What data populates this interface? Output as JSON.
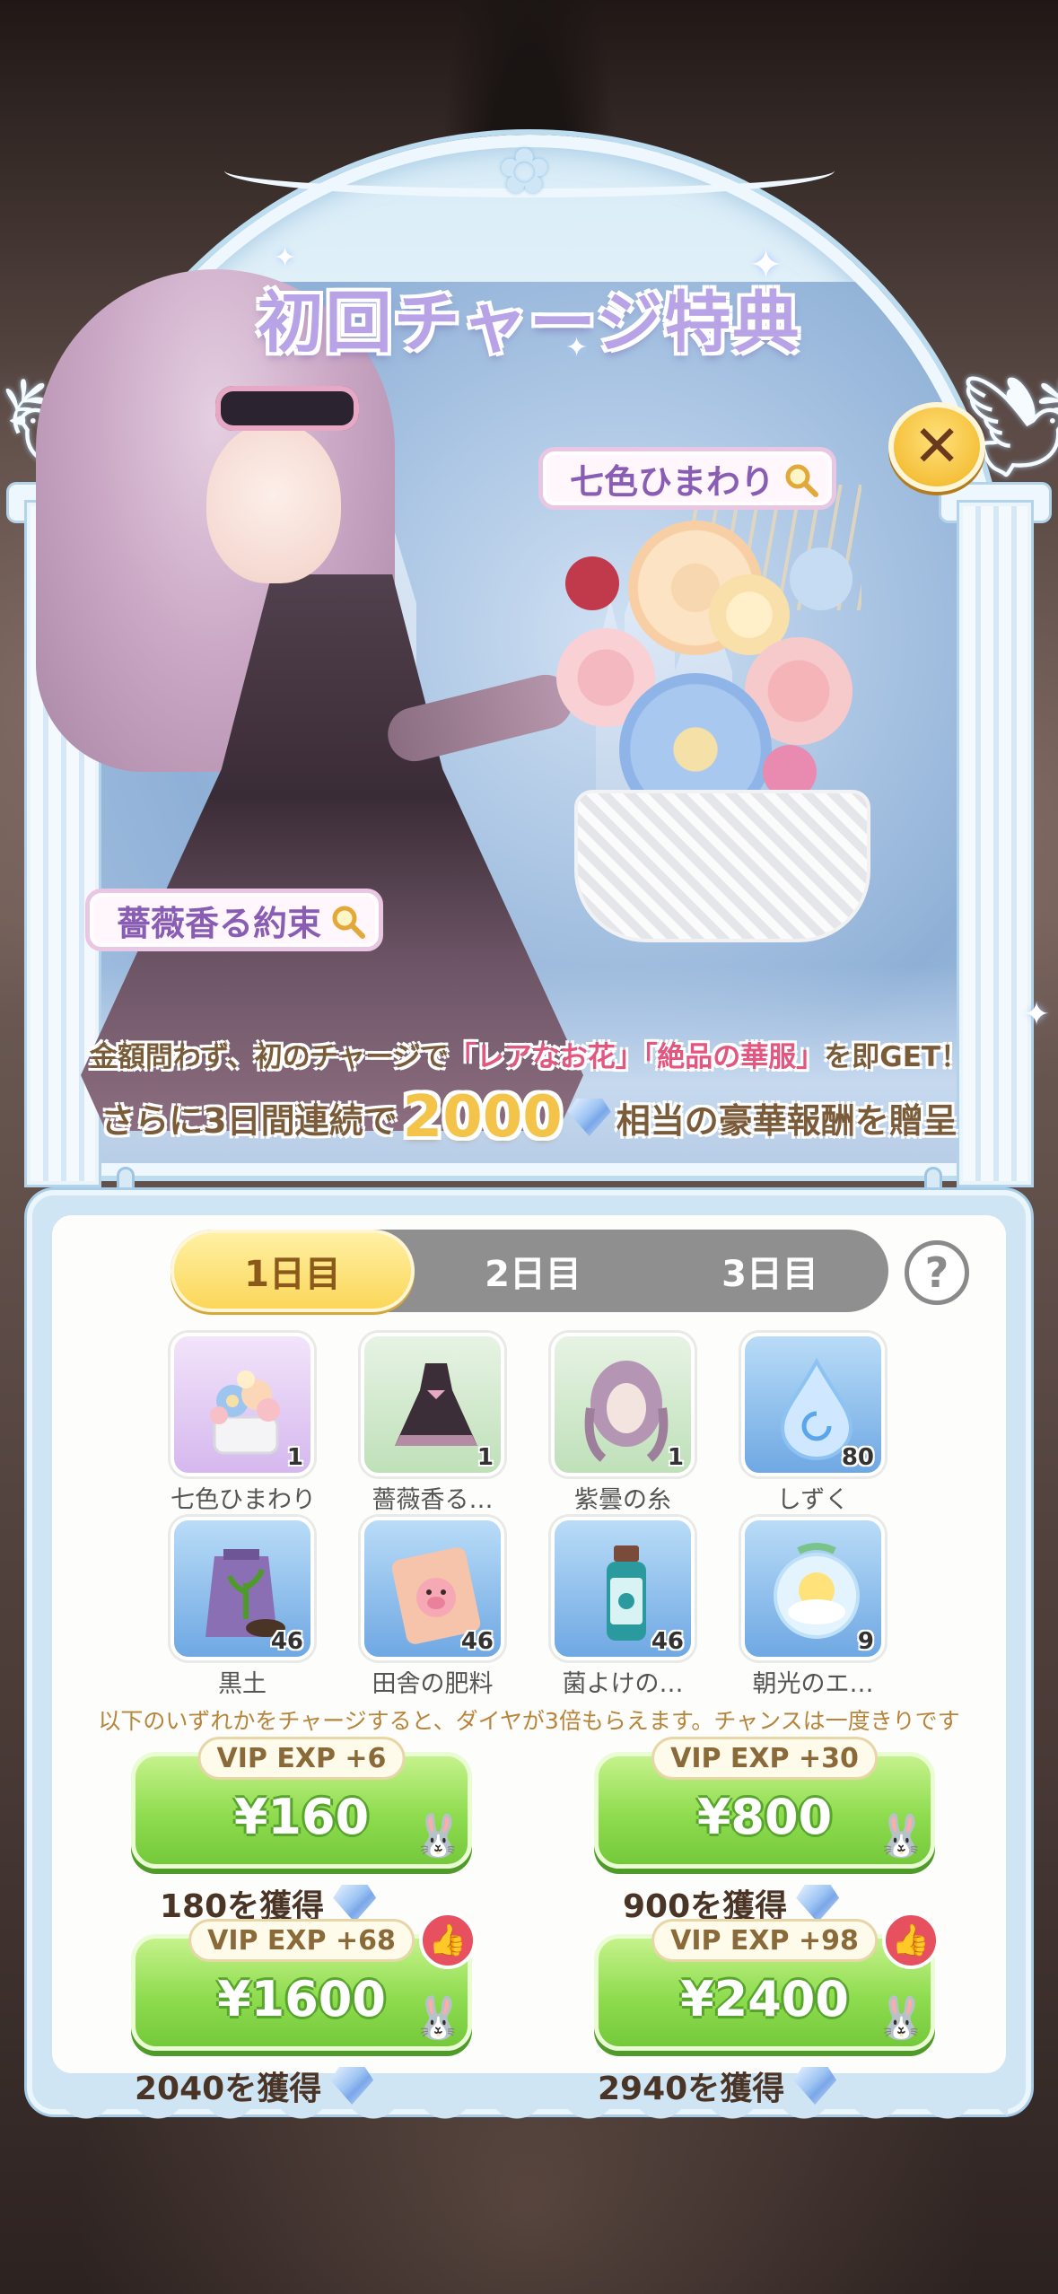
{
  "banner": {
    "title": "初回チャージ特典",
    "close_icon": "close-icon",
    "tags": [
      {
        "label": "七色ひまわり",
        "icon": "magnifier-icon"
      },
      {
        "label": "薔薇香る約束",
        "icon": "magnifier-icon"
      }
    ],
    "desc_line1_prefix": "金額問わず、初のチャージで",
    "desc_line1_hl1": "「レアなお花」",
    "desc_line1_hl2": "「絶品の華服」",
    "desc_line1_suffix": "を即GET！",
    "desc_line2_prefix": "さらに3日間連続で",
    "desc_line2_amount": "2000",
    "desc_line2_suffix": "相当の豪華報酬を贈呈"
  },
  "tabs": [
    {
      "label": "1日目",
      "active": true
    },
    {
      "label": "2日目",
      "active": false
    },
    {
      "label": "3日目",
      "active": false
    }
  ],
  "help_label": "?",
  "rewards": [
    {
      "name": "七色ひまわり",
      "qty": "1",
      "frame": "purple",
      "icon": "flower-basket-icon"
    },
    {
      "name": "薔薇香る…",
      "qty": "1",
      "frame": "green",
      "icon": "dress-icon"
    },
    {
      "name": "紫曇の糸",
      "qty": "1",
      "frame": "green",
      "icon": "hair-icon"
    },
    {
      "name": "しずく",
      "qty": "80",
      "frame": "blue",
      "icon": "water-drop-icon"
    },
    {
      "name": "黒土",
      "qty": "46",
      "frame": "blue",
      "icon": "soil-bag-icon"
    },
    {
      "name": "田舎の肥料",
      "qty": "46",
      "frame": "blue",
      "icon": "fertilizer-icon"
    },
    {
      "name": "菌よけの…",
      "qty": "46",
      "frame": "blue",
      "icon": "bottle-icon"
    },
    {
      "name": "朝光のエ…",
      "qty": "9",
      "frame": "blue",
      "icon": "sun-globe-icon"
    }
  ],
  "note": "以下のいずれかをチャージすると、ダイヤが3倍もらえます。チャンスは一度きりです",
  "packages": [
    {
      "vip": "VIP EXP +6",
      "price": "¥160",
      "gain": "180を獲得",
      "liked": false
    },
    {
      "vip": "VIP EXP +30",
      "price": "¥800",
      "gain": "900を獲得",
      "liked": false
    },
    {
      "vip": "VIP EXP +68",
      "price": "¥1600",
      "gain": "2040を獲得",
      "liked": true
    },
    {
      "vip": "VIP EXP +98",
      "price": "¥2400",
      "gain": "2940を獲得",
      "liked": true
    }
  ],
  "colors": {
    "title": "#b7a3e6",
    "tab_active": "#fbd75a",
    "buy_button": "#8fdc4f",
    "highlight": "#e2567f",
    "amount": "#f4c34a"
  }
}
